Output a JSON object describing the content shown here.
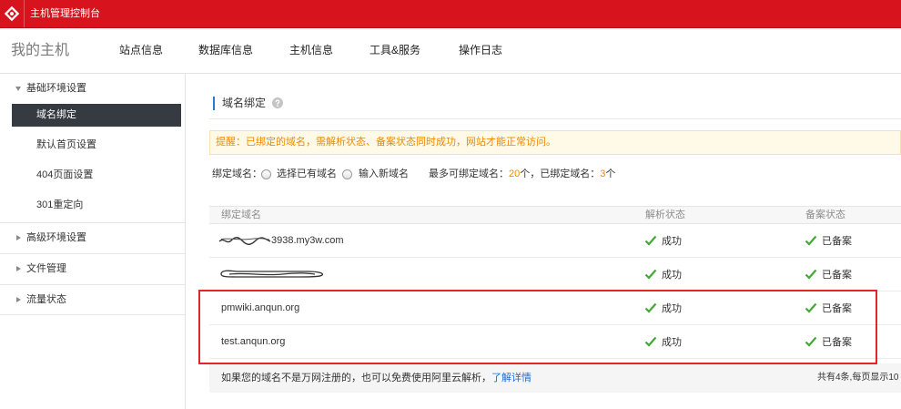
{
  "theme": {
    "brand_red": "#d7141d",
    "title_accent": "#2a7ad2",
    "notice_text": "#ec8a00",
    "count_highlight": "#f08a00",
    "link": "#1a6ed8",
    "success": "#43a935",
    "annotation": "#e3262a"
  },
  "icons": {
    "logo": "wanwang-logo-icon",
    "help": "help-circle-icon",
    "status_ok": "check-icon",
    "expanded": "triangle-down-icon",
    "collapsed": "triangle-right-icon"
  },
  "topbar": {
    "title": "主机管理控制台"
  },
  "nav": {
    "home": "我的主机",
    "tabs": [
      "站点信息",
      "数据库信息",
      "主机信息",
      "工具&服务",
      "操作日志"
    ]
  },
  "sidebar": {
    "groups": [
      {
        "label": "基础环境设置",
        "expanded": true,
        "items": [
          {
            "label": "域名绑定",
            "active": true
          },
          {
            "label": "默认首页设置"
          },
          {
            "label": "404页面设置"
          },
          {
            "label": "301重定向"
          }
        ]
      },
      {
        "label": "高级环境设置",
        "expanded": false
      },
      {
        "label": "文件管理",
        "expanded": false
      },
      {
        "label": "流量状态",
        "expanded": false
      }
    ]
  },
  "main": {
    "title": "域名绑定",
    "notice": "提醒：已绑定的域名，需解析状态、备案状态同时成功，网站才能正常访问。",
    "bind_form": {
      "label": "绑定域名：",
      "option_existing": "选择已有域名",
      "option_new": "输入新域名",
      "limit_prefix": "最多可绑定域名：",
      "max_count": "20",
      "limit_mid": "个，已绑定域名：",
      "bound_count": "3",
      "limit_suffix": "个"
    },
    "table": {
      "columns": [
        "绑定域名",
        "解析状态",
        "备案状态"
      ],
      "rows": [
        {
          "domain": "3938.my3w.com",
          "domain_redacted": true,
          "resolve_status": "成功",
          "record_status": "已备案"
        },
        {
          "domain_redacted": true,
          "resolve_status": "成功",
          "record_status": "已备案"
        },
        {
          "domain": "pmwiki.anqun.org",
          "domain_redacted": false,
          "resolve_status": "成功",
          "record_status": "已备案"
        },
        {
          "domain": "test.anqun.org",
          "domain_redacted": false,
          "resolve_status": "成功",
          "record_status": "已备案"
        }
      ]
    },
    "footer": {
      "hint": "如果您的域名不是万网注册的，也可以免费使用阿里云解析，",
      "link": "了解详情",
      "pagination": "共有4条,每页显示10"
    }
  }
}
